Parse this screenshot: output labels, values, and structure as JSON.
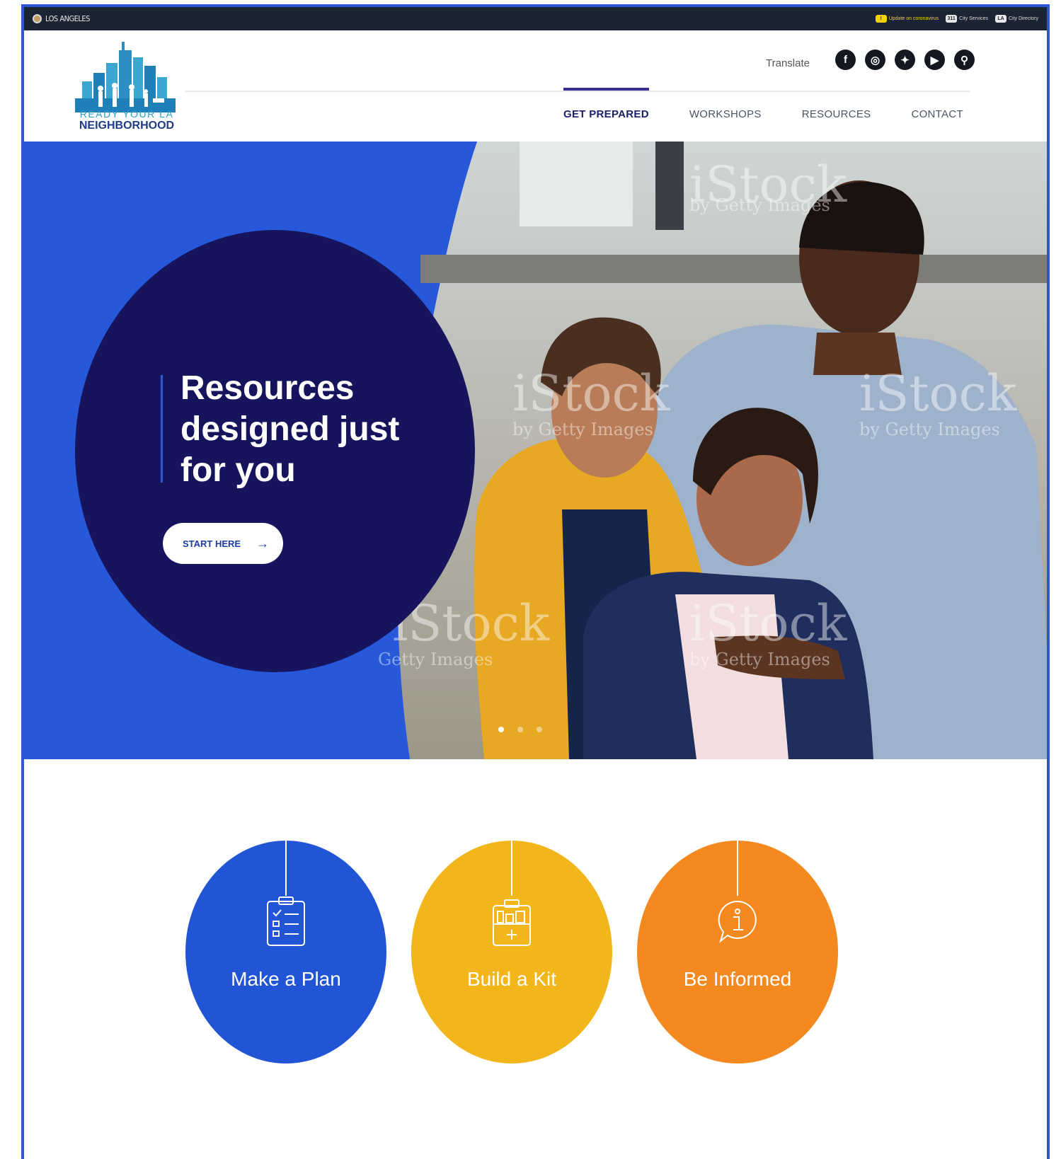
{
  "colors": {
    "hero_blue": "#2658d9",
    "hero_navy": "#17145e",
    "plan_blue": "#2254d6",
    "kit_yellow": "#f2b61a",
    "informed_orange": "#f48a1f",
    "topbar": "#1b2433"
  },
  "topbar": {
    "city": "LOS ANGELES",
    "links": [
      {
        "badge": "!",
        "label": "Update on coronavirus",
        "icon": "alert-icon"
      },
      {
        "badge": "311",
        "label": "City Services",
        "icon": "311-badge"
      },
      {
        "badge": "LA",
        "label": "City Directory",
        "icon": "la-badge"
      }
    ]
  },
  "header": {
    "logo_line1": "READY YOUR LA",
    "logo_line2": "NEIGHBORHOOD",
    "translate": "Translate",
    "social": [
      {
        "icon": "facebook-icon",
        "glyph": "f"
      },
      {
        "icon": "instagram-icon",
        "glyph": "◎"
      },
      {
        "icon": "twitter-icon",
        "glyph": "✦"
      },
      {
        "icon": "youtube-icon",
        "glyph": "▶"
      },
      {
        "icon": "search-icon",
        "glyph": "⚲"
      }
    ],
    "nav": [
      {
        "label": "GET PREPARED",
        "active": true
      },
      {
        "label": "WORKSHOPS",
        "active": false
      },
      {
        "label": "RESOURCES",
        "active": false
      },
      {
        "label": "CONTACT",
        "active": false
      }
    ]
  },
  "hero": {
    "title": "Resources designed just for you",
    "cta": "START HERE",
    "watermark": "iStock",
    "watermark_sub": "by Getty Images",
    "slides": 3,
    "active_slide": 1
  },
  "features": [
    {
      "label": "Make a Plan",
      "icon": "clipboard-checklist-icon"
    },
    {
      "label": "Build a Kit",
      "icon": "emergency-kit-icon"
    },
    {
      "label": "Be Informed",
      "icon": "info-bubble-icon"
    }
  ]
}
